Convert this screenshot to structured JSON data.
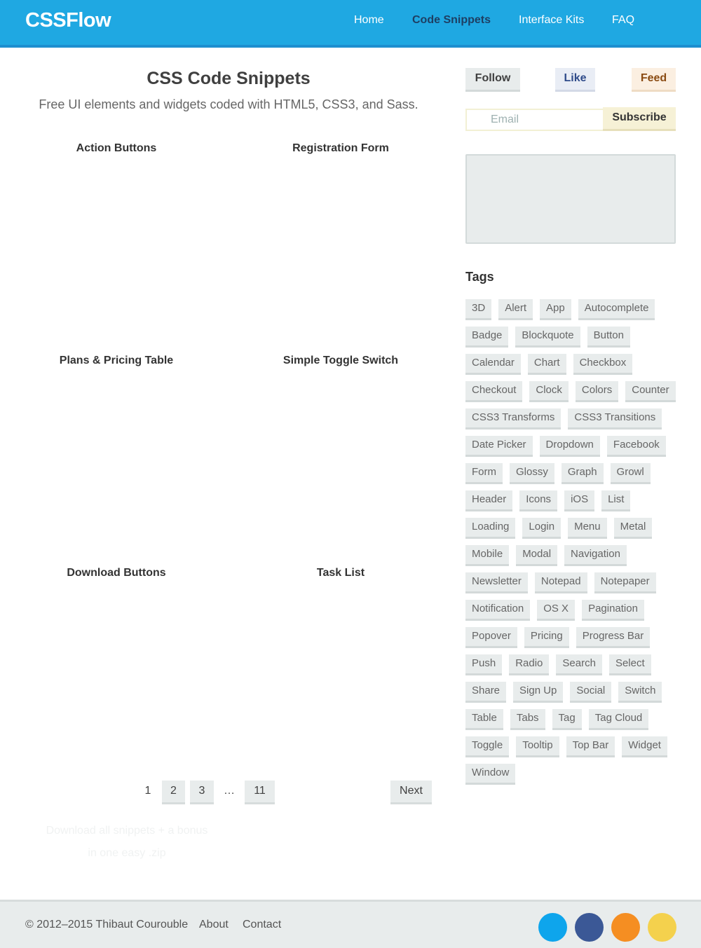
{
  "brand": {
    "logo": "CSSFlow"
  },
  "nav": [
    "Home",
    "Code Snippets",
    "Interface Kits",
    "FAQ"
  ],
  "main": {
    "title": "CSS Code Snippets",
    "subtitle": "Free UI elements and widgets coded with HTML5, CSS3, and Sass.",
    "snippets": [
      "Action Buttons",
      "Registration Form",
      "Plans & Pricing Table",
      "Simple Toggle Switch",
      "Download Buttons",
      "Task List"
    ],
    "pagination": {
      "pages": [
        "1",
        "2",
        "3",
        "…",
        "11"
      ],
      "current": "1",
      "next": "Next"
    },
    "download": {
      "line1": "Download all snippets + a bonus",
      "line2": "in one easy .zip"
    }
  },
  "sidebar": {
    "social": {
      "follow": "Follow",
      "like": "Like",
      "feed": "Feed"
    },
    "email_placeholder": "Email",
    "subscribe": "Subscribe",
    "tags_title": "Tags",
    "tags": [
      "3D",
      "Alert",
      "App",
      "Autocomplete",
      "Badge",
      "Blockquote",
      "Button",
      "Calendar",
      "Chart",
      "Checkbox",
      "Checkout",
      "Clock",
      "Colors",
      "Counter",
      "CSS3 Transforms",
      "CSS3 Transitions",
      "Date Picker",
      "Dropdown",
      "Facebook",
      "Form",
      "Glossy",
      "Graph",
      "Growl",
      "Header",
      "Icons",
      "iOS",
      "List",
      "Loading",
      "Login",
      "Menu",
      "Metal",
      "Mobile",
      "Modal",
      "Navigation",
      "Newsletter",
      "Notepad",
      "Notepaper",
      "Notification",
      "OS X",
      "Pagination",
      "Popover",
      "Pricing",
      "Progress Bar",
      "Push",
      "Radio",
      "Search",
      "Select",
      "Share",
      "Sign Up",
      "Social",
      "Switch",
      "Table",
      "Tabs",
      "Tag",
      "Tag Cloud",
      "Toggle",
      "Tooltip",
      "Top Bar",
      "Widget",
      "Window"
    ]
  },
  "footer": {
    "copyright": "© 2012–2015 Thibaut Courouble",
    "links": [
      "About",
      "Contact"
    ],
    "social_colors": [
      "#0ea5ec",
      "#3b5896",
      "#f58e22",
      "#f4d14d"
    ]
  }
}
